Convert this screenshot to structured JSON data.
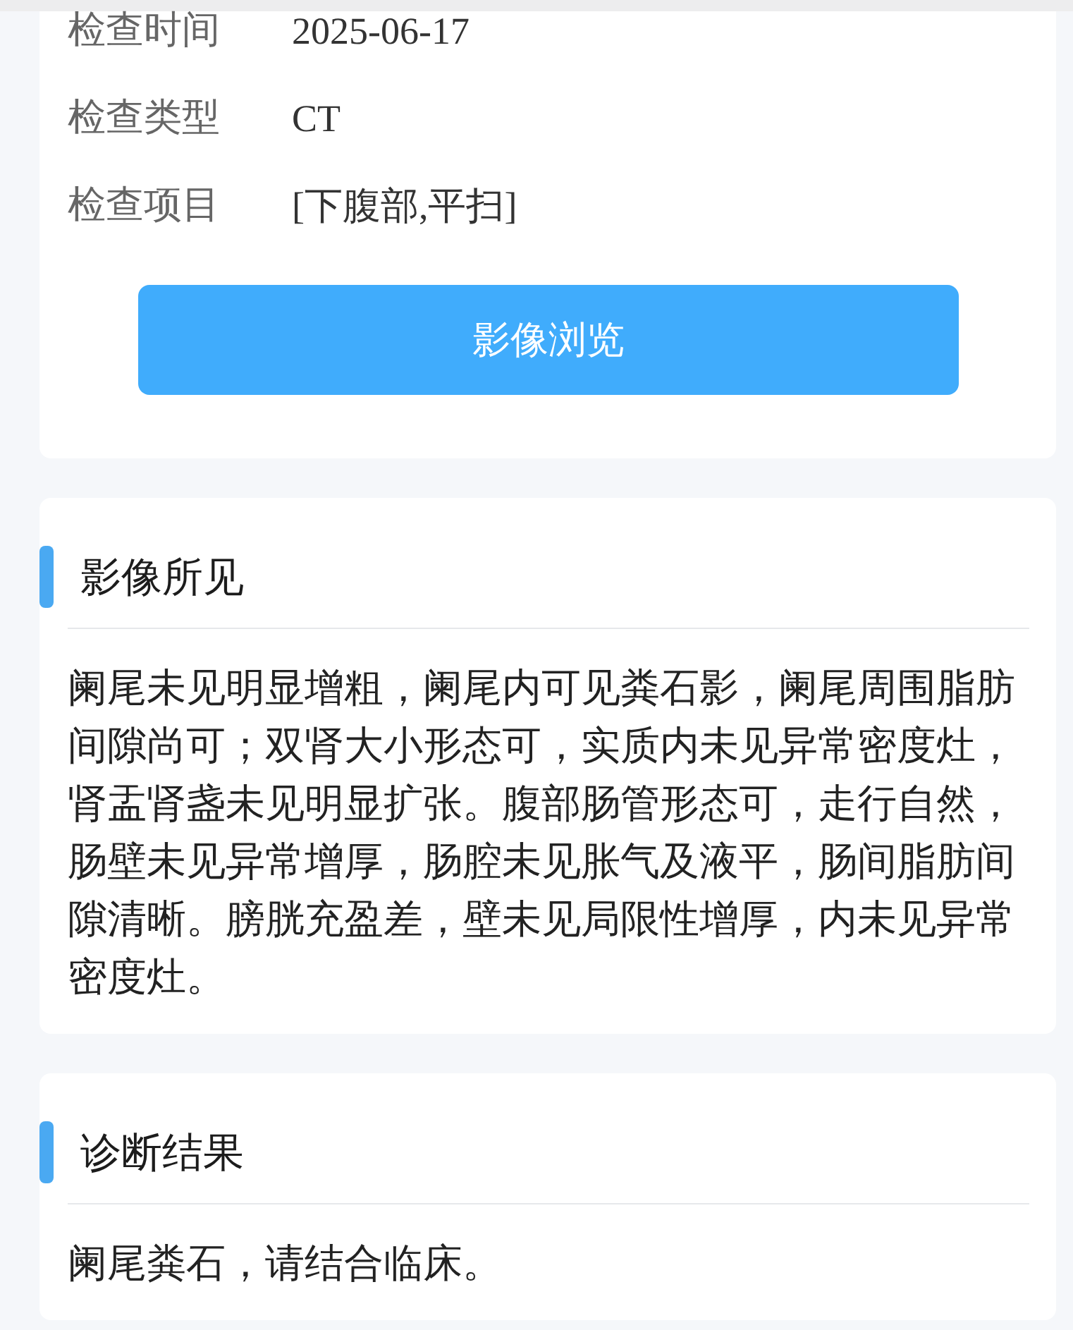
{
  "info_rows": [
    {
      "label": "检查时间",
      "value": "2025-06-17"
    },
    {
      "label": "检查类型",
      "value": "CT"
    },
    {
      "label": "检查项目",
      "value": "[下腹部,平扫]"
    }
  ],
  "view_button": {
    "label": "影像浏览"
  },
  "sections": [
    {
      "title": "影像所见",
      "text": "阑尾未见明显增粗，阑尾内可见粪石影，阑尾周围脂肪间隙尚可；双肾大小形态可，实质内未见异常密度灶，肾盂肾盏未见明显扩张。腹部肠管形态可，走行自然，肠壁未见异常增厚，肠腔未见胀气及液平，肠间脂肪间隙清晰。膀胱充盈差，壁未见局限性增厚，内未见异常密度灶。"
    },
    {
      "title": "诊断结果",
      "text": "阑尾粪石，请结合临床。"
    }
  ]
}
